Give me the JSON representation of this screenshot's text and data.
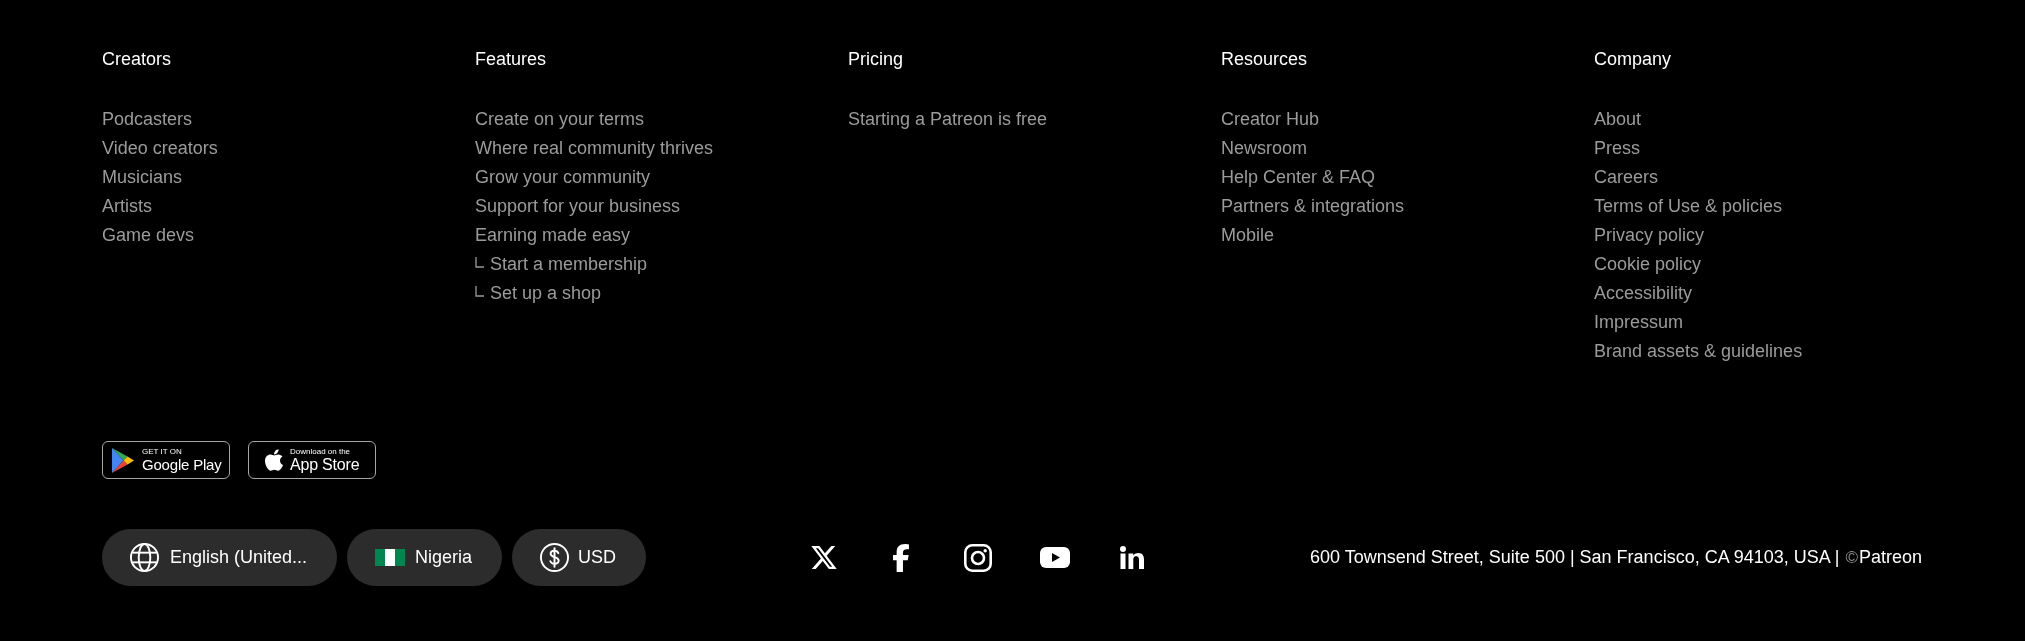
{
  "columns": [
    {
      "heading": "Creators",
      "links": [
        {
          "label": "Podcasters"
        },
        {
          "label": "Video creators"
        },
        {
          "label": "Musicians"
        },
        {
          "label": "Artists"
        },
        {
          "label": "Game devs"
        }
      ]
    },
    {
      "heading": "Features",
      "links": [
        {
          "label": "Create on your terms"
        },
        {
          "label": "Where real community thrives"
        },
        {
          "label": "Grow your community"
        },
        {
          "label": "Support for your business"
        },
        {
          "label": "Earning made easy",
          "children": [
            {
              "label": "Start a membership"
            },
            {
              "label": "Set up a shop"
            }
          ]
        }
      ]
    },
    {
      "heading": "Pricing",
      "links": [
        {
          "label": "Starting a Patreon is free"
        }
      ]
    },
    {
      "heading": "Resources",
      "links": [
        {
          "label": "Creator Hub"
        },
        {
          "label": "Newsroom"
        },
        {
          "label": "Help Center & FAQ"
        },
        {
          "label": "Partners & integrations"
        },
        {
          "label": "Mobile"
        }
      ]
    },
    {
      "heading": "Company",
      "links": [
        {
          "label": "About"
        },
        {
          "label": "Press"
        },
        {
          "label": "Careers"
        },
        {
          "label": "Terms of Use & policies"
        },
        {
          "label": "Privacy policy"
        },
        {
          "label": "Cookie policy"
        },
        {
          "label": "Accessibility"
        },
        {
          "label": "Impressum"
        },
        {
          "label": "Brand assets & guidelines"
        }
      ]
    }
  ],
  "app_badges": [
    {
      "kind": "google_play",
      "caption": "GET IT ON",
      "store": "Google Play"
    },
    {
      "kind": "app_store",
      "caption": "Download on the",
      "store": "App Store"
    }
  ],
  "selectors": [
    {
      "kind": "language",
      "label": "English (United..."
    },
    {
      "kind": "country",
      "label": "Nigeria"
    },
    {
      "kind": "currency",
      "label": "USD"
    }
  ],
  "address_bar": {
    "address": "600 Townsend Street, Suite 500 | San Francisco, CA 94103, USA |",
    "copyright_mark": "©",
    "owner": "Patreon"
  }
}
